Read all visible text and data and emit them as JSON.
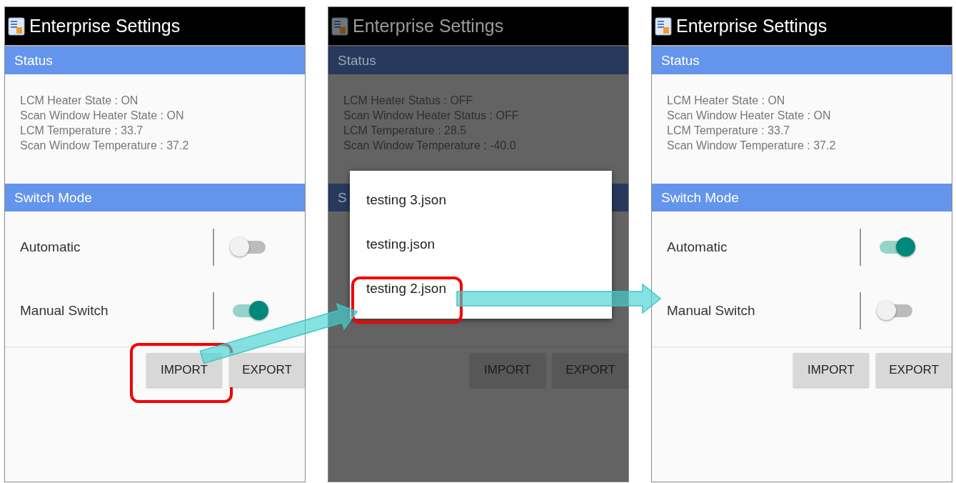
{
  "screens": [
    {
      "title": "Enterprise Settings",
      "dimmed": false,
      "status_header": "Status",
      "status_lines": [
        "LCM Heater State : ON",
        "Scan Window Heater State : ON",
        "LCM Temperature : 33.7",
        "Scan Window Temperature : 37.2"
      ],
      "mode_header": "Switch Mode",
      "switches": [
        {
          "label": "Automatic",
          "on": false
        },
        {
          "label": "Manual Switch",
          "on": true
        }
      ],
      "buttons": [
        {
          "label": "IMPORT",
          "highlighted": true
        },
        {
          "label": "EXPORT",
          "highlighted": false
        }
      ]
    },
    {
      "title": "Enterprise Settings",
      "dimmed": true,
      "status_header": "Status",
      "status_lines": [
        "LCM Heater Status : OFF",
        "Scan Window Heater Status : OFF",
        "LCM Temperature : 28.5",
        "Scan Window Temperature : -40.0"
      ],
      "mode_header": "S",
      "buttons": [
        {
          "label": "IMPORT",
          "highlighted": false
        },
        {
          "label": "EXPORT",
          "highlighted": false
        }
      ],
      "dialog": {
        "items": [
          {
            "label": "testing 3.json",
            "highlighted": false
          },
          {
            "label": "testing.json",
            "highlighted": false
          },
          {
            "label": "testing 2.json",
            "highlighted": true
          }
        ]
      }
    },
    {
      "title": "Enterprise Settings",
      "dimmed": false,
      "status_header": "Status",
      "status_lines": [
        "LCM Heater State : ON",
        "Scan Window Heater State : ON",
        "LCM Temperature : 33.7",
        "Scan Window Temperature : 37.2"
      ],
      "mode_header": "Switch Mode",
      "switches": [
        {
          "label": "Automatic",
          "on": true
        },
        {
          "label": "Manual Switch",
          "on": false
        }
      ],
      "buttons": [
        {
          "label": "IMPORT",
          "highlighted": false
        },
        {
          "label": "EXPORT",
          "highlighted": false
        }
      ]
    }
  ]
}
